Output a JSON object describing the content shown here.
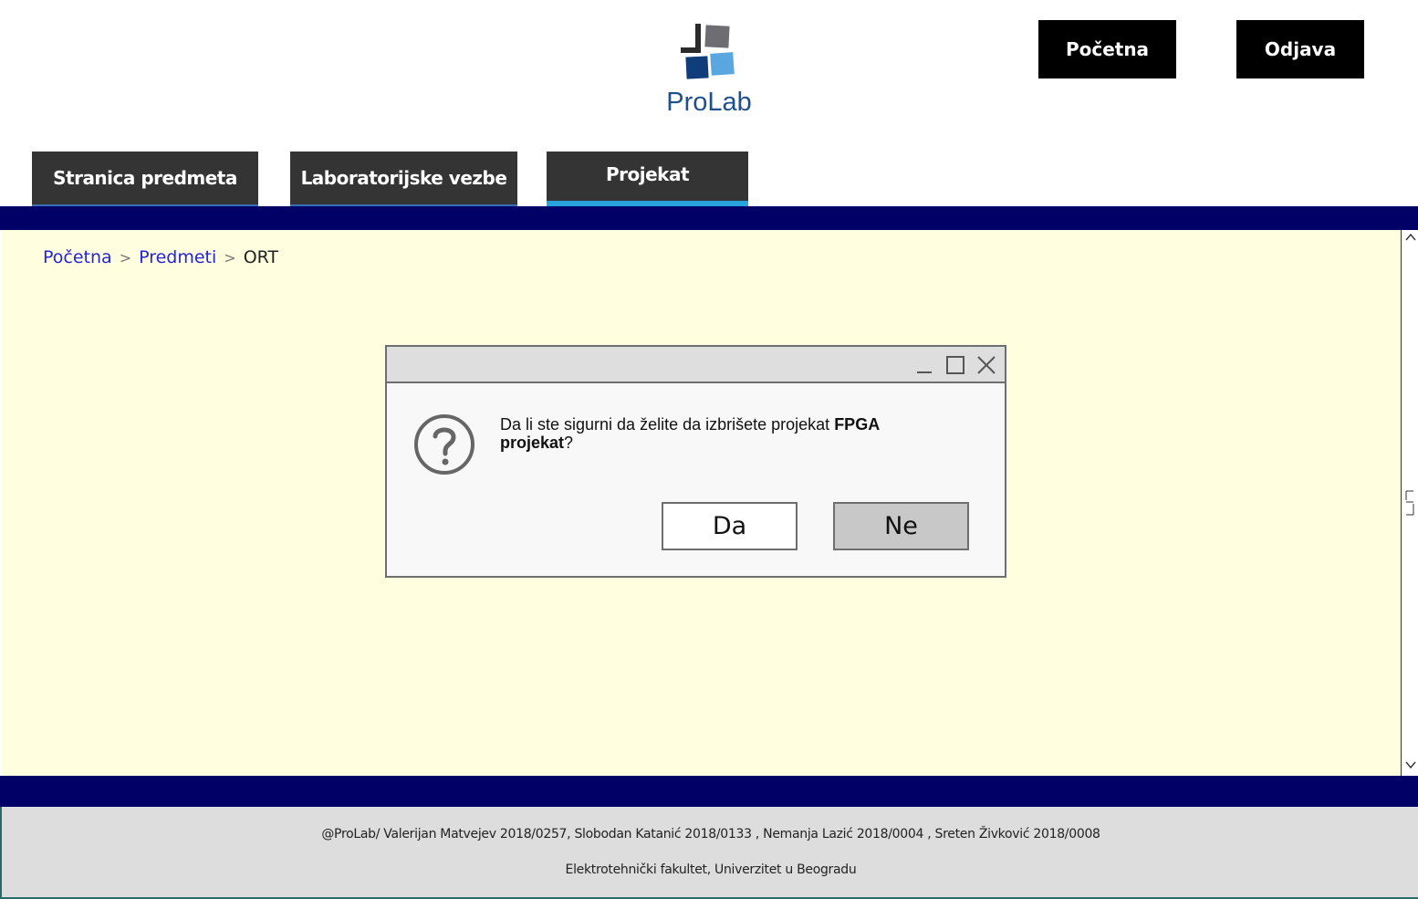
{
  "header": {
    "logo_text": "ProLab",
    "home_button": "Početna",
    "logout_button": "Odjava"
  },
  "tabs": [
    {
      "label": "Stranica predmeta"
    },
    {
      "label": "Laboratorijske vezbe"
    },
    {
      "label": "Projekat",
      "active": true
    }
  ],
  "breadcrumb": {
    "items": [
      "Početna",
      "Predmeti",
      "ORT"
    ],
    "separator": ">"
  },
  "dialog": {
    "message_prefix": "Da li ste sigurni da želite da izbrišete projekat ",
    "project_name": "FPGA projekat",
    "message_suffix": "?",
    "yes_label": "Da",
    "no_label": "Ne",
    "icon": "question-circle-icon"
  },
  "footer": {
    "authors": "@ProLab/ Valerijan Matvejev 2018/0257, Slobodan Katanić 2018/0133 , Nemanja Lazić 2018/0004 , Sreten Živković 2018/0008",
    "institution": "Elektrotehnički fakultet, Univerzitet u Beogradu"
  },
  "colors": {
    "band": "#000066",
    "content_bg": "#ffffdf",
    "tab_bg": "#343434",
    "active_tab_underline": "#29a3e0",
    "link": "#2424d8"
  }
}
